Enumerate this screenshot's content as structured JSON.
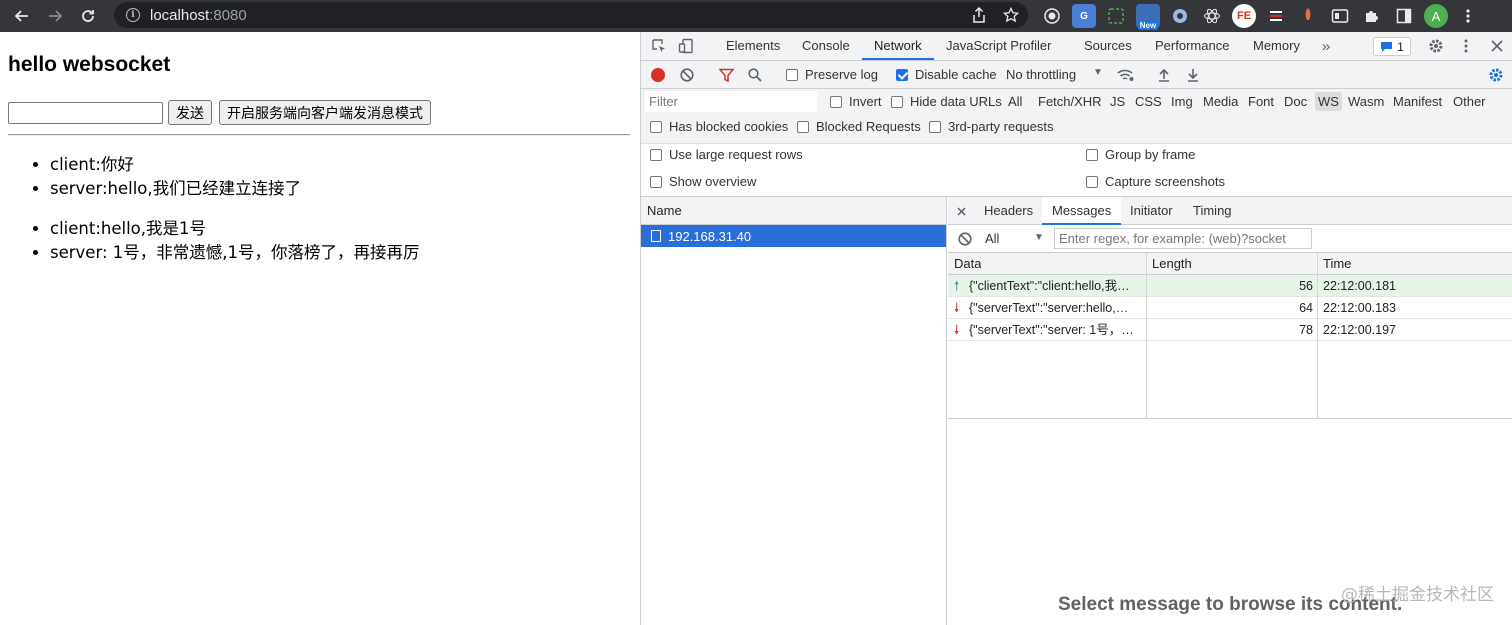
{
  "browser": {
    "url_host": "localhost",
    "url_port": ":8080",
    "extension_badge": "New",
    "avatar_letter": "A",
    "fe_label": "FE"
  },
  "page": {
    "title": "hello websocket",
    "input_value": "",
    "send_label": "发送",
    "mode_label": "开启服务端向客户端发消息模式",
    "messages_group1": [
      "client:你好",
      "server:hello,我们已经建立连接了"
    ],
    "messages_group2": [
      "client:hello,我是1号",
      "server: 1号，非常遗憾,1号，你落榜了，再接再厉"
    ]
  },
  "devtools": {
    "tabs": [
      "Elements",
      "Console",
      "Network",
      "JavaScript Profiler",
      "Sources",
      "Performance",
      "Memory"
    ],
    "issues_count": "1",
    "toolbar": {
      "preserve_log": "Preserve log",
      "disable_cache": "Disable cache",
      "throttling": "No throttling"
    },
    "filter": {
      "placeholder": "Filter",
      "invert": "Invert",
      "hide_data_urls": "Hide data URLs",
      "types": [
        "All",
        "Fetch/XHR",
        "JS",
        "CSS",
        "Img",
        "Media",
        "Font",
        "Doc",
        "WS",
        "Wasm",
        "Manifest",
        "Other"
      ],
      "selected_type": "WS",
      "blocked_cookies": "Has blocked cookies",
      "blocked_requests": "Blocked Requests",
      "third_party": "3rd-party requests"
    },
    "settings": {
      "large_rows": "Use large request rows",
      "show_overview": "Show overview",
      "group_by_frame": "Group by frame",
      "capture_screenshots": "Capture screenshots"
    },
    "name_header": "Name",
    "request_name": "192.168.31.40",
    "detail_tabs": [
      "Headers",
      "Messages",
      "Initiator",
      "Timing"
    ],
    "messages_filter": "All",
    "regex_placeholder": "Enter regex, for example: (web)?socket",
    "grid_headers": [
      "Data",
      "Length",
      "Time"
    ],
    "rows": [
      {
        "dir": "sent",
        "data": "{\"clientText\":\"client:hello,我…",
        "length": "56",
        "time": "22:12:00.181"
      },
      {
        "dir": "received",
        "data": "{\"serverText\":\"server:hello,…",
        "length": "64",
        "time": "22:12:00.183"
      },
      {
        "dir": "received",
        "data": "{\"serverText\":\"server: 1号，…",
        "length": "78",
        "time": "22:12:00.197"
      }
    ],
    "empty_message": "Select message to browse its content."
  },
  "watermark": "@稀土掘金技术社区"
}
